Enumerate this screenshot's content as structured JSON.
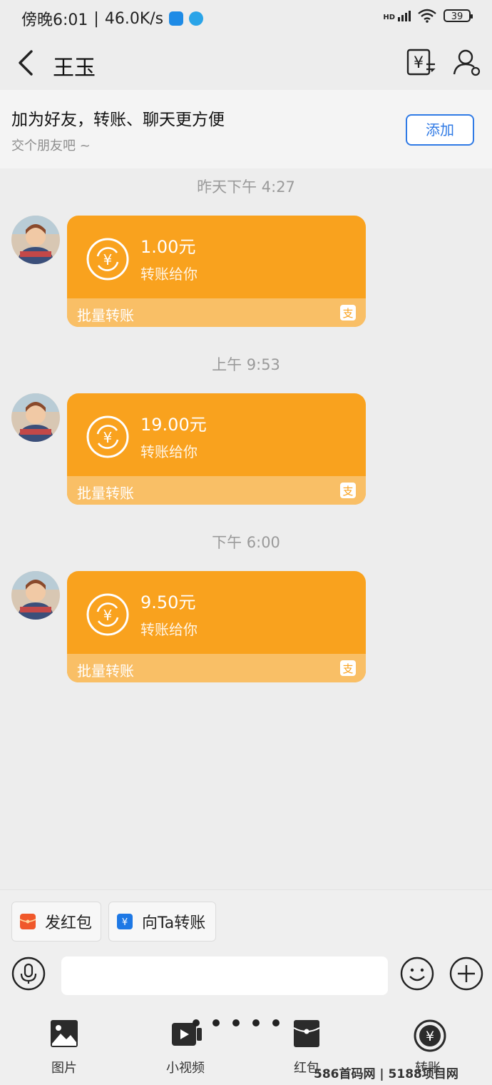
{
  "status_bar": {
    "time": "傍晚6:01",
    "network_speed": "46.0K/s",
    "battery": "39",
    "signal_label": "HD"
  },
  "header": {
    "title": "王玉"
  },
  "friend_banner": {
    "title": "加为好友，转账、聊天更方便",
    "subtitle": "交个朋友吧 ~",
    "add_label": "添加"
  },
  "messages": [
    {
      "timestamp": "昨天下午 4:27",
      "amount": "1.00元",
      "subtitle": "转账给你",
      "type": "批量转账"
    },
    {
      "timestamp": "上午 9:53",
      "amount": "19.00元",
      "subtitle": "转账给你",
      "type": "批量转账"
    },
    {
      "timestamp": "下午 6:00",
      "amount": "9.50元",
      "subtitle": "转账给你",
      "type": "批量转账"
    }
  ],
  "quick_actions": {
    "red_packet": "发红包",
    "transfer": "向Ta转账"
  },
  "input": {
    "placeholder": "",
    "value": ""
  },
  "toolbar": {
    "items": [
      {
        "label": "图片"
      },
      {
        "label": "小视频"
      },
      {
        "label": "红包"
      },
      {
        "label": "转账"
      }
    ]
  },
  "watermark": {
    "text": "586首码网 | 5188项目网"
  },
  "colors": {
    "card": "#f9a21e",
    "card_footer": "#f9bf66",
    "accent_blue": "#2f7ae5",
    "background": "#ededed"
  }
}
